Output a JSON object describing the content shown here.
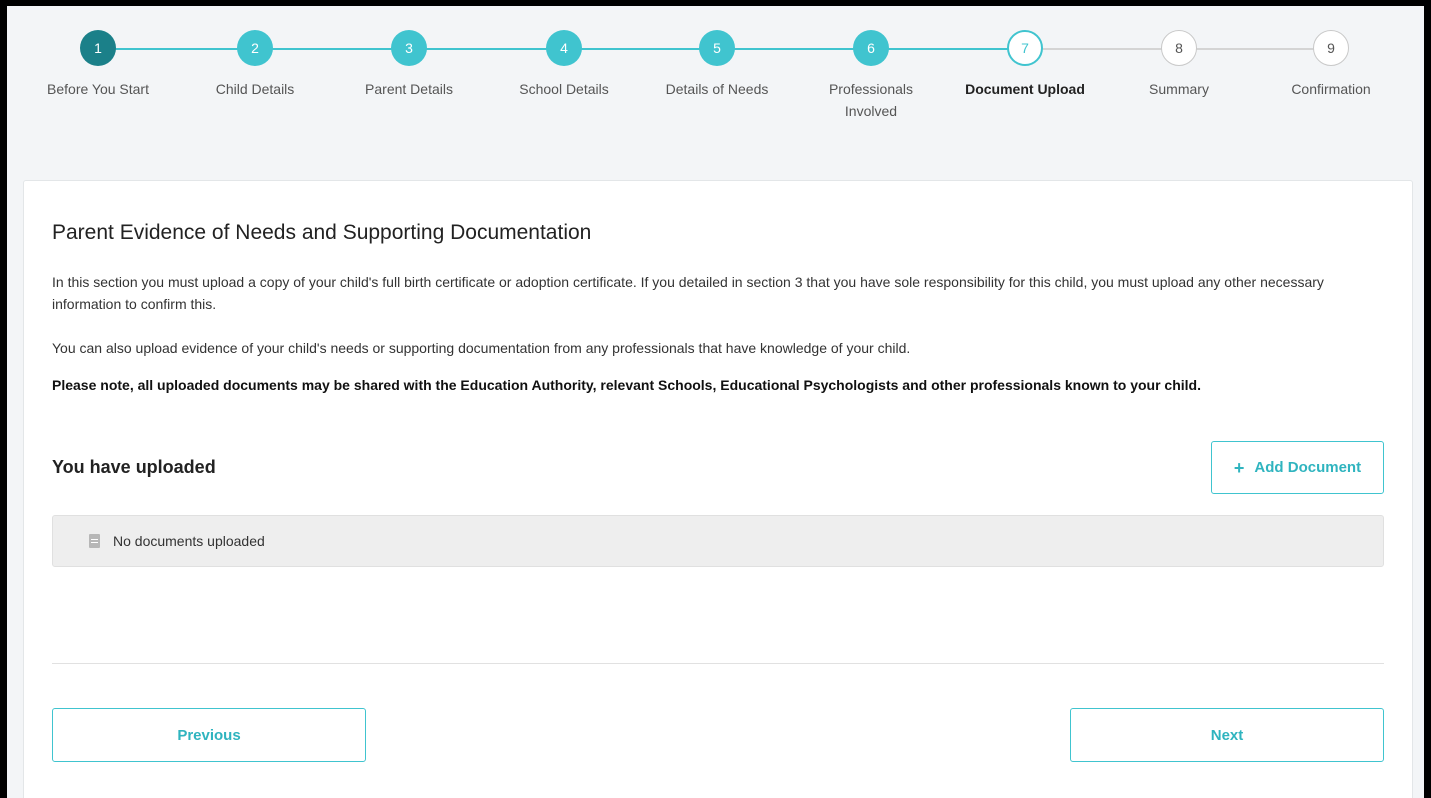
{
  "stepper": {
    "steps": [
      {
        "number": "1",
        "label": "Before You Start",
        "state": "completed"
      },
      {
        "number": "2",
        "label": "Child Details",
        "state": "completed"
      },
      {
        "number": "3",
        "label": "Parent Details",
        "state": "completed"
      },
      {
        "number": "4",
        "label": "School Details",
        "state": "completed"
      },
      {
        "number": "5",
        "label": "Details of Needs",
        "state": "completed"
      },
      {
        "number": "6",
        "label": "Professionals Involved",
        "state": "completed"
      },
      {
        "number": "7",
        "label": "Document Upload",
        "state": "current"
      },
      {
        "number": "8",
        "label": "Summary",
        "state": "upcoming"
      },
      {
        "number": "9",
        "label": "Confirmation",
        "state": "upcoming"
      }
    ]
  },
  "main": {
    "title": "Parent Evidence of Needs and Supporting Documentation",
    "paragraph_1": "In this section you must upload a copy of your child's full birth certificate or adoption certificate. If you detailed in section 3 that you have sole responsibility for this child, you must upload any other necessary information to confirm this.",
    "paragraph_2": "You can also upload evidence of your child's needs or supporting documentation from any professionals that have knowledge of your child.",
    "notice": "Please note, all uploaded documents may be shared with the Education Authority, relevant Schools, Educational Psychologists and other professionals known to your child.",
    "uploaded_heading": "You have uploaded",
    "add_document_label": "Add Document",
    "empty_uploads_text": "No documents uploaded",
    "previous_label": "Previous",
    "next_label": "Next"
  },
  "colors": {
    "accent": "#40c4cf",
    "first_step": "#1b8089",
    "upcoming_border": "#c9c9c9"
  },
  "icons": {
    "add": "plus-icon",
    "document": "document-icon"
  }
}
